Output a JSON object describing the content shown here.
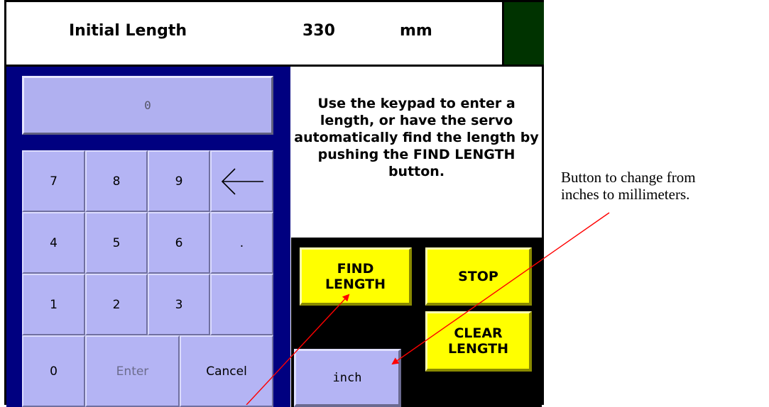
{
  "header": {
    "title": "Initial Length",
    "value": "330",
    "unit": "mm"
  },
  "keypad": {
    "display_value": "0",
    "keys": {
      "k7": "7",
      "k8": "8",
      "k9": "9",
      "k4": "4",
      "k5": "5",
      "k6": "6",
      "dot": ".",
      "k1": "1",
      "k2": "2",
      "k3": "3",
      "k0": "0",
      "enter": "Enter",
      "cancel": "Cancel"
    },
    "backspace_icon": "left-arrow-icon"
  },
  "instructions": "Use the keypad to enter a length, or have the servo automatically find the length by pushing the FIND LENGTH button.",
  "controls": {
    "find_length_line1": "FIND",
    "find_length_line2": "LENGTH",
    "stop": "STOP",
    "clear_length_line1": "CLEAR",
    "clear_length_line2": "LENGTH",
    "unit_toggle": "inch"
  },
  "annotation": {
    "line1": "Button to change from",
    "line2": "inches to millimeters."
  },
  "colors": {
    "keypad_bg": "#000080",
    "key": "#b4b4f4",
    "action_button": "#ffff00",
    "status_led": "#003300",
    "arrow": "#ff0000"
  }
}
